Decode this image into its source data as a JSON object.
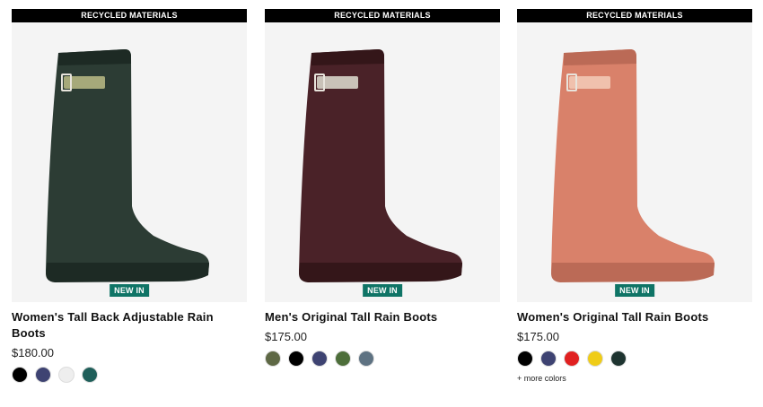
{
  "products": [
    {
      "banner": "RECYCLED MATERIALS",
      "badge": "NEW IN",
      "title": "Women's Tall Back Adjustable Rain Boots",
      "price": "$180.00",
      "boot_color": "#2c3c34",
      "boot_shadow": "#1d2a24",
      "strap_color": "#a6a97a",
      "swatches": [
        "#000000",
        "#3e4372",
        "#eeeeee",
        "#1f5f5a"
      ]
    },
    {
      "banner": "RECYCLED MATERIALS",
      "badge": "NEW IN",
      "title": "Men's Original Tall Rain Boots",
      "price": "$175.00",
      "boot_color": "#4a2228",
      "boot_shadow": "#341619",
      "strap_color": "#c9c2b8",
      "swatches": [
        "#5e6845",
        "#000000",
        "#3e4372",
        "#4d6e3a",
        "#5e7282"
      ]
    },
    {
      "banner": "RECYCLED MATERIALS",
      "badge": "NEW IN",
      "title": "Women's Original Tall Rain Boots",
      "price": "$175.00",
      "boot_color": "#d9816a",
      "boot_shadow": "#bb6a56",
      "strap_color": "#f0c1ad",
      "swatches": [
        "#000000",
        "#3e4372",
        "#e02020",
        "#efcc18",
        "#1e3430"
      ],
      "more_colors": "+ more colors"
    }
  ]
}
